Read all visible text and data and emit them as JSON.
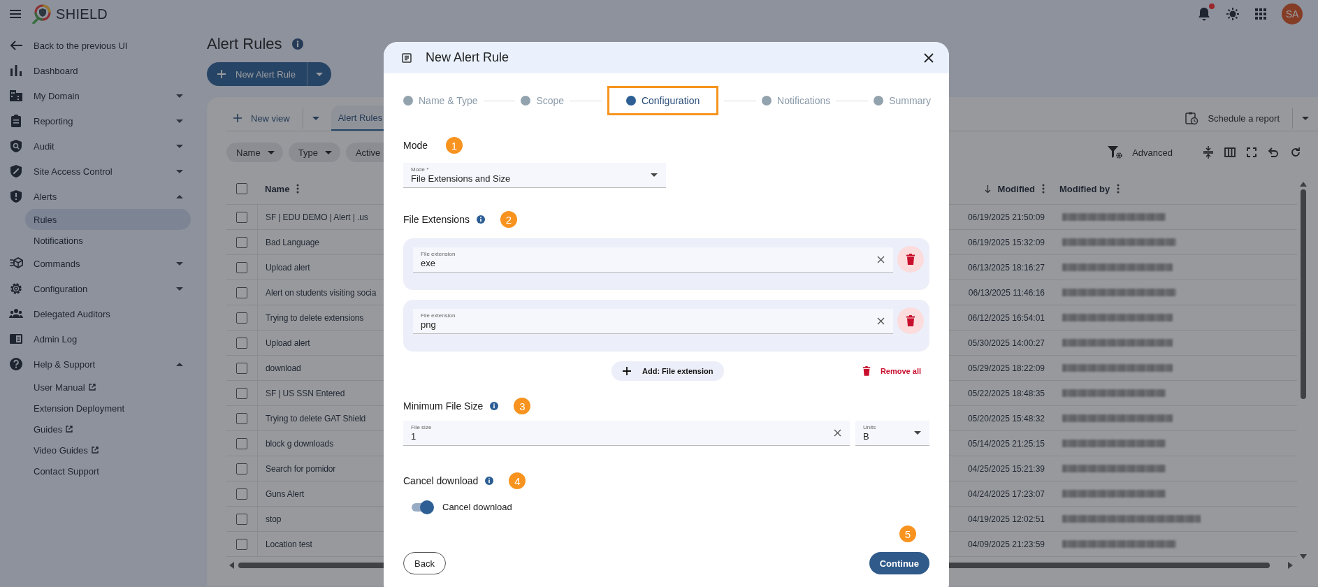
{
  "header": {
    "app_name": "SHIELD",
    "avatar": "SA",
    "notifications_unread": true
  },
  "sidebar": {
    "items": [
      {
        "label": "Back to the previous UI",
        "kind": "link"
      },
      {
        "label": "Dashboard",
        "kind": "link"
      },
      {
        "label": "My Domain",
        "kind": "group",
        "expanded": false
      },
      {
        "label": "Reporting",
        "kind": "group",
        "expanded": false
      },
      {
        "label": "Audit",
        "kind": "group",
        "expanded": false
      },
      {
        "label": "Site Access Control",
        "kind": "group",
        "expanded": false
      },
      {
        "label": "Alerts",
        "kind": "group",
        "expanded": true,
        "children": [
          {
            "label": "Rules",
            "selected": true,
            "external": false
          },
          {
            "label": "Notifications",
            "selected": false,
            "external": false
          }
        ]
      },
      {
        "label": "Commands",
        "kind": "group",
        "expanded": false
      },
      {
        "label": "Configuration",
        "kind": "group",
        "expanded": false
      },
      {
        "label": "Delegated Auditors",
        "kind": "link"
      },
      {
        "label": "Admin Log",
        "kind": "link"
      },
      {
        "label": "Help & Support",
        "kind": "group",
        "expanded": true,
        "children": [
          {
            "label": "User Manual",
            "selected": false,
            "external": true
          },
          {
            "label": "Extension Deployment",
            "selected": false,
            "external": false
          },
          {
            "label": "Guides",
            "selected": false,
            "external": true
          },
          {
            "label": "Video Guides",
            "selected": false,
            "external": true
          },
          {
            "label": "Contact Support",
            "selected": false,
            "external": false
          }
        ]
      }
    ]
  },
  "page": {
    "title": "Alert Rules",
    "new_button": "New Alert Rule"
  },
  "views": {
    "new_view": "New view",
    "tabs": [
      {
        "label": "Alert Rules",
        "selected": true
      }
    ],
    "schedule": "Schedule a report"
  },
  "filters": {
    "chips": [
      "Name",
      "Type",
      "Active"
    ],
    "advanced": "Advanced"
  },
  "table": {
    "all_selected": false,
    "columns": [
      {
        "label": "Name",
        "sorted": false
      },
      {
        "label": "Modified",
        "sorted": true
      },
      {
        "label": "Modified by",
        "sorted": false
      }
    ],
    "rows": [
      {
        "name": "SF | EDU DEMO | Alert | .us",
        "modified": "06/19/2025 21:50:09",
        "checked": false
      },
      {
        "name": "Bad Language",
        "modified": "06/19/2025 15:32:09",
        "checked": false
      },
      {
        "name": "Upload alert",
        "modified": "06/13/2025 18:16:27",
        "checked": false
      },
      {
        "name": "Alert on students visiting socia",
        "modified": "06/13/2025 11:46:16",
        "checked": false
      },
      {
        "name": "Trying to delete extensions",
        "modified": "06/12/2025 16:54:01",
        "checked": false
      },
      {
        "name": "Upload alert",
        "modified": "05/30/2025 14:00:27",
        "checked": false
      },
      {
        "name": "download",
        "modified": "05/29/2025 18:22:09",
        "checked": false
      },
      {
        "name": "SF | US SSN Entered",
        "modified": "05/22/2025 18:48:35",
        "checked": false
      },
      {
        "name": "Trying to delete GAT Shield",
        "modified": "05/20/2025 15:48:32",
        "checked": false
      },
      {
        "name": "block g downloads",
        "modified": "05/14/2025 21:25:15",
        "checked": false
      },
      {
        "name": "Search for pomidor",
        "modified": "04/25/2025 15:21:39",
        "checked": false
      },
      {
        "name": "Guns Alert",
        "modified": "04/24/2025 17:23:07",
        "checked": false
      },
      {
        "name": "stop",
        "modified": "04/19/2025 12:02:51",
        "checked": false
      },
      {
        "name": "Location test",
        "modified": "04/09/2025 21:23:59",
        "checked": false
      }
    ]
  },
  "dialog": {
    "title": "New Alert Rule",
    "steps": [
      {
        "label": "Name & Type",
        "selected": false,
        "highlighted": false
      },
      {
        "label": "Scope",
        "selected": false,
        "highlighted": false
      },
      {
        "label": "Configuration",
        "selected": true,
        "highlighted": true
      },
      {
        "label": "Notifications",
        "selected": false,
        "highlighted": false
      },
      {
        "label": "Summary",
        "selected": false,
        "highlighted": false
      }
    ],
    "mode": {
      "heading": "Mode",
      "badge": "1",
      "field_label": "Mode *",
      "value": "File Extensions and Size"
    },
    "extensions": {
      "heading": "File Extensions",
      "badge": "2",
      "info": true,
      "items": [
        {
          "label": "File extension",
          "value": "exe"
        },
        {
          "label": "File extension",
          "value": "png"
        }
      ],
      "add_button": "Add: File extension",
      "remove_all": "Remove all"
    },
    "min_size": {
      "heading": "Minimum File Size",
      "badge": "3",
      "info": true,
      "size_label": "File size",
      "size_value": "1",
      "units_label": "Units",
      "units_value": "B"
    },
    "cancel": {
      "heading": "Cancel download",
      "badge": "4",
      "info": true,
      "toggle_label": "Cancel download",
      "on": true
    },
    "footer": {
      "back": "Back",
      "continue": "Continue",
      "badge": "5"
    }
  }
}
